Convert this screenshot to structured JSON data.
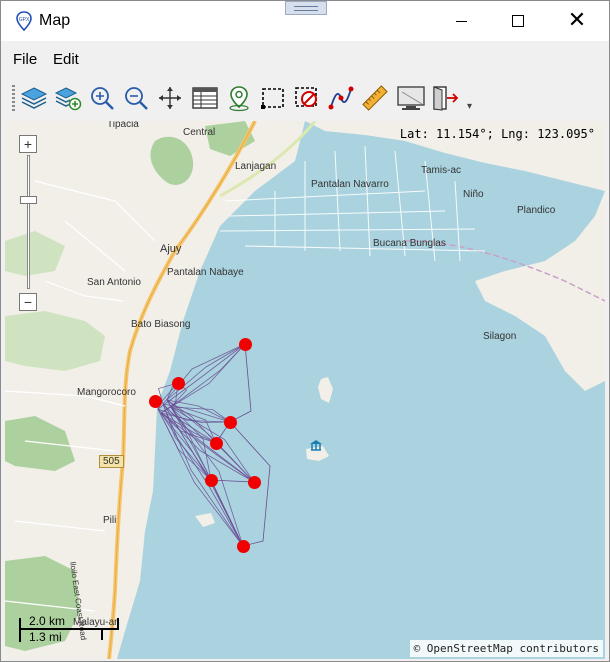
{
  "window": {
    "title": "Map"
  },
  "menu": {
    "items": [
      "File",
      "Edit"
    ]
  },
  "toolbar": {
    "buttons": [
      {
        "name": "layers-icon"
      },
      {
        "name": "add-layer-icon"
      },
      {
        "name": "zoom-in-icon"
      },
      {
        "name": "zoom-out-icon"
      },
      {
        "name": "pan-icon"
      },
      {
        "name": "table-icon"
      },
      {
        "name": "location-pin-icon"
      },
      {
        "name": "select-area-icon"
      },
      {
        "name": "clear-selection-icon"
      },
      {
        "name": "draw-path-icon"
      },
      {
        "name": "measure-ruler-icon"
      },
      {
        "name": "screenshot-icon"
      },
      {
        "name": "exit-icon"
      }
    ],
    "more": "▾"
  },
  "map": {
    "coordinates": "Lat: 11.154°; Lng: 123.095°",
    "zoom_in_label": "+",
    "zoom_out_label": "−",
    "scale_km": "2.0 km",
    "scale_mi": "1.3 mi",
    "attribution": "© OpenStreetMap contributors",
    "road_shield": "505",
    "road_name": "Iloilo East Coast Road",
    "place_labels": [
      {
        "text": "Tipacia"
      },
      {
        "text": "Central"
      },
      {
        "text": "Lanjagan"
      },
      {
        "text": "Pantalan Navarro"
      },
      {
        "text": "Tamis-ac"
      },
      {
        "text": "Niño"
      },
      {
        "text": "Plandico"
      },
      {
        "text": "Ajuy"
      },
      {
        "text": "Bucana Bunglas"
      },
      {
        "text": "Pantalan Nabaye"
      },
      {
        "text": "San Antonio"
      },
      {
        "text": "Silagon"
      },
      {
        "text": "Bato Biasong"
      },
      {
        "text": "Mangorocoro"
      },
      {
        "text": "Pili"
      },
      {
        "text": "Malayu-an"
      }
    ],
    "colors": {
      "water": "#aad3df",
      "land": "#f2efe9",
      "forest": "#add19e",
      "marker": "#f00000",
      "track": "#6a4c93",
      "road": "#f7c46a"
    }
  }
}
